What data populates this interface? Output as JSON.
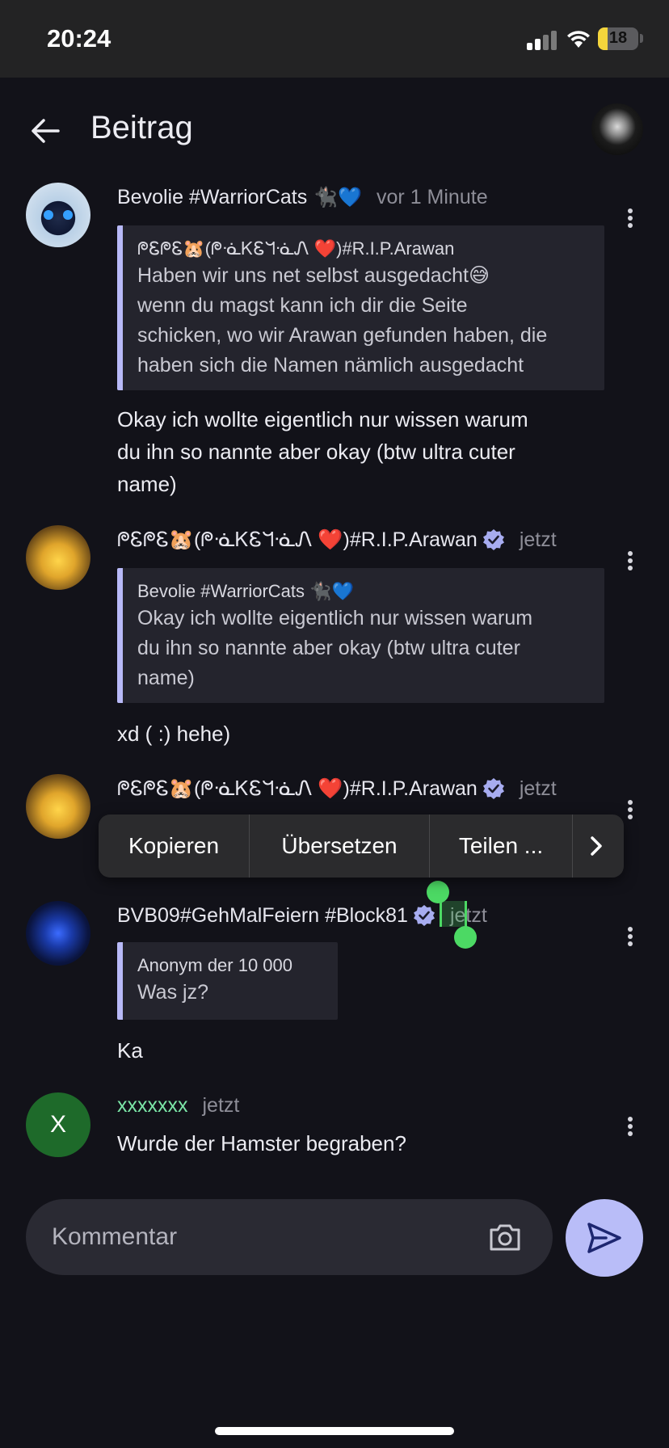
{
  "status_bar": {
    "time": "20:24",
    "battery": "18",
    "battery_color": "#f4d53c"
  },
  "header": {
    "title": "Beitrag",
    "back_icon": "arrow-left-icon",
    "profile_avatar": "profile-avatar"
  },
  "comments": [
    {
      "author": "Bevolie #WarriorCats",
      "author_emoji": "🐈‍⬛💙",
      "time": "vor 1 Minute",
      "quote": {
        "author": "ᖘᏋᖘᏋ🐹(ᖘᓍᏦᏋᖻᓍᏁ ❤️)#R.I.P.Arawan",
        "lines": [
          "Haben wir uns net selbst ausgedacht😅",
          "wenn du magst kann ich dir die Seite",
          "schicken, wo wir Arawan gefunden haben, die",
          "haben sich die Namen nämlich ausgedacht"
        ]
      },
      "text_lines": [
        "Okay ich wollte eigentlich nur wissen warum",
        "du ihn so nannte aber okay (btw ultra cuter",
        "name)"
      ]
    },
    {
      "author": "ᖘᏋᖘᏋ🐹(ᖘᓍᏦᏋᖻᓍᏁ ❤️)#R.I.P.Arawan",
      "verified": true,
      "time": "jetzt",
      "quote": {
        "author": "Bevolie #WarriorCats 🐈‍⬛💙",
        "lines": [
          "Okay ich wollte eigentlich nur wissen warum",
          "du ihn so nannte aber okay (btw ultra cuter",
          "name)"
        ]
      },
      "text_lines": [
        "xd ( :) hehe)"
      ]
    },
    {
      "author": "ᖘᏋᖘᏋ🐹(ᖘᓍᏦᏋᖻᓍᏁ ❤️)#R.I.P.Arawan",
      "verified": true,
      "time": "jetzt"
    },
    {
      "author": "BVB09#GehMalFeiern #Block81",
      "verified": true,
      "time": "jetzt",
      "quote": {
        "author": "Anonym der 10 000",
        "lines": [
          "Was jz?"
        ]
      },
      "text_lines": [
        "Ka"
      ]
    },
    {
      "author": "xxxxxxx",
      "avatar_letter": "X",
      "time": "jetzt",
      "text_lines": [
        "Wurde der Hamster begraben?"
      ]
    }
  ],
  "context_menu": {
    "items": [
      "Kopieren",
      "Übersetzen",
      "Teilen ..."
    ],
    "more_icon": "chevron-right-icon"
  },
  "composer": {
    "placeholder": "Kommentar",
    "camera_icon": "camera-icon",
    "send_icon": "send-icon"
  },
  "colors": {
    "background": "#121219",
    "quote_bar": "#b8b9f7",
    "send_button": "#b9bdf8",
    "selection": "#4cd964",
    "username_green": "#7be6a7"
  }
}
